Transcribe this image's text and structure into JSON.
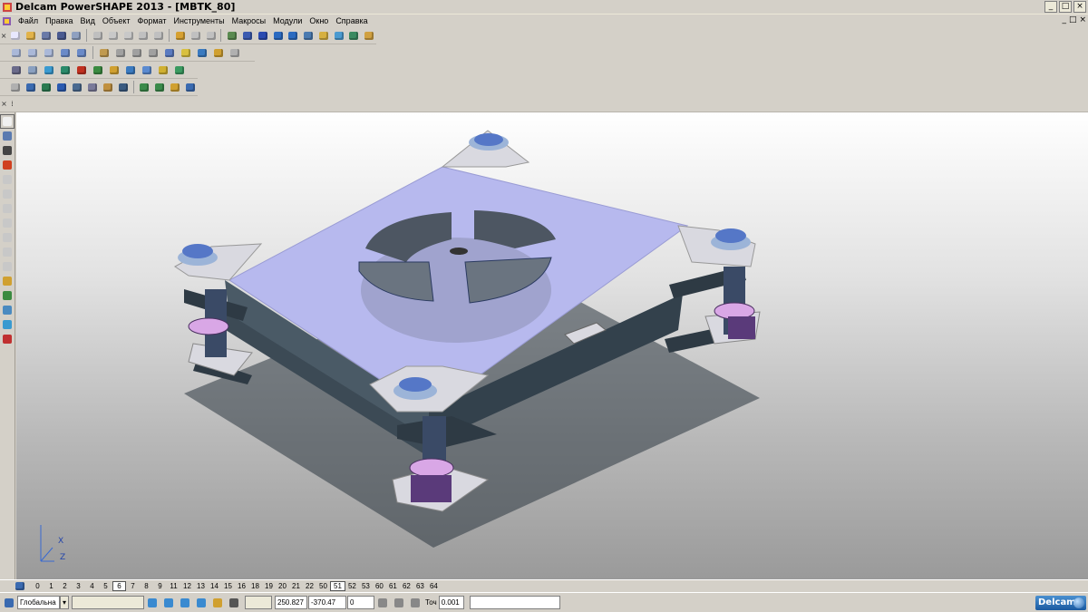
{
  "window": {
    "title": "Delcam PowerSHAPE 2013 - [MBTK_80]",
    "controls": [
      "_",
      "□",
      "×"
    ]
  },
  "menubar": {
    "items": [
      "Файл",
      "Правка",
      "Вид",
      "Объект",
      "Формат",
      "Инструменты",
      "Макросы",
      "Модули",
      "Окно",
      "Справка"
    ],
    "mdi_controls": [
      "_",
      "□",
      "×"
    ]
  },
  "toolbars": {
    "row1_handle": "×",
    "row4_handle": "×"
  },
  "levels": {
    "items": [
      "0",
      "1",
      "2",
      "3",
      "4",
      "5",
      "6",
      "7",
      "8",
      "9",
      "11",
      "12",
      "13",
      "14",
      "15",
      "16",
      "18",
      "19",
      "20",
      "21",
      "22",
      "50",
      "51",
      "52",
      "53",
      "60",
      "61",
      "62",
      "63",
      "64"
    ],
    "highlighted": [
      "6",
      "51"
    ]
  },
  "statusbar": {
    "workplane": "Глобальна",
    "coord_x": "250.827",
    "coord_y": "-370.47",
    "level_value": "0",
    "tolerance_label": "Точ",
    "tolerance_value": "0.001",
    "logo": "Delcam"
  },
  "viewport": {
    "axis_x": "X",
    "axis_z": "Z"
  },
  "colors": {
    "plate_top": "#b7b9ee",
    "body_side": "#3f4f5c",
    "bracket": "#d9d9e0",
    "cap": "#5577c7",
    "collar": "#d9a7e6"
  }
}
